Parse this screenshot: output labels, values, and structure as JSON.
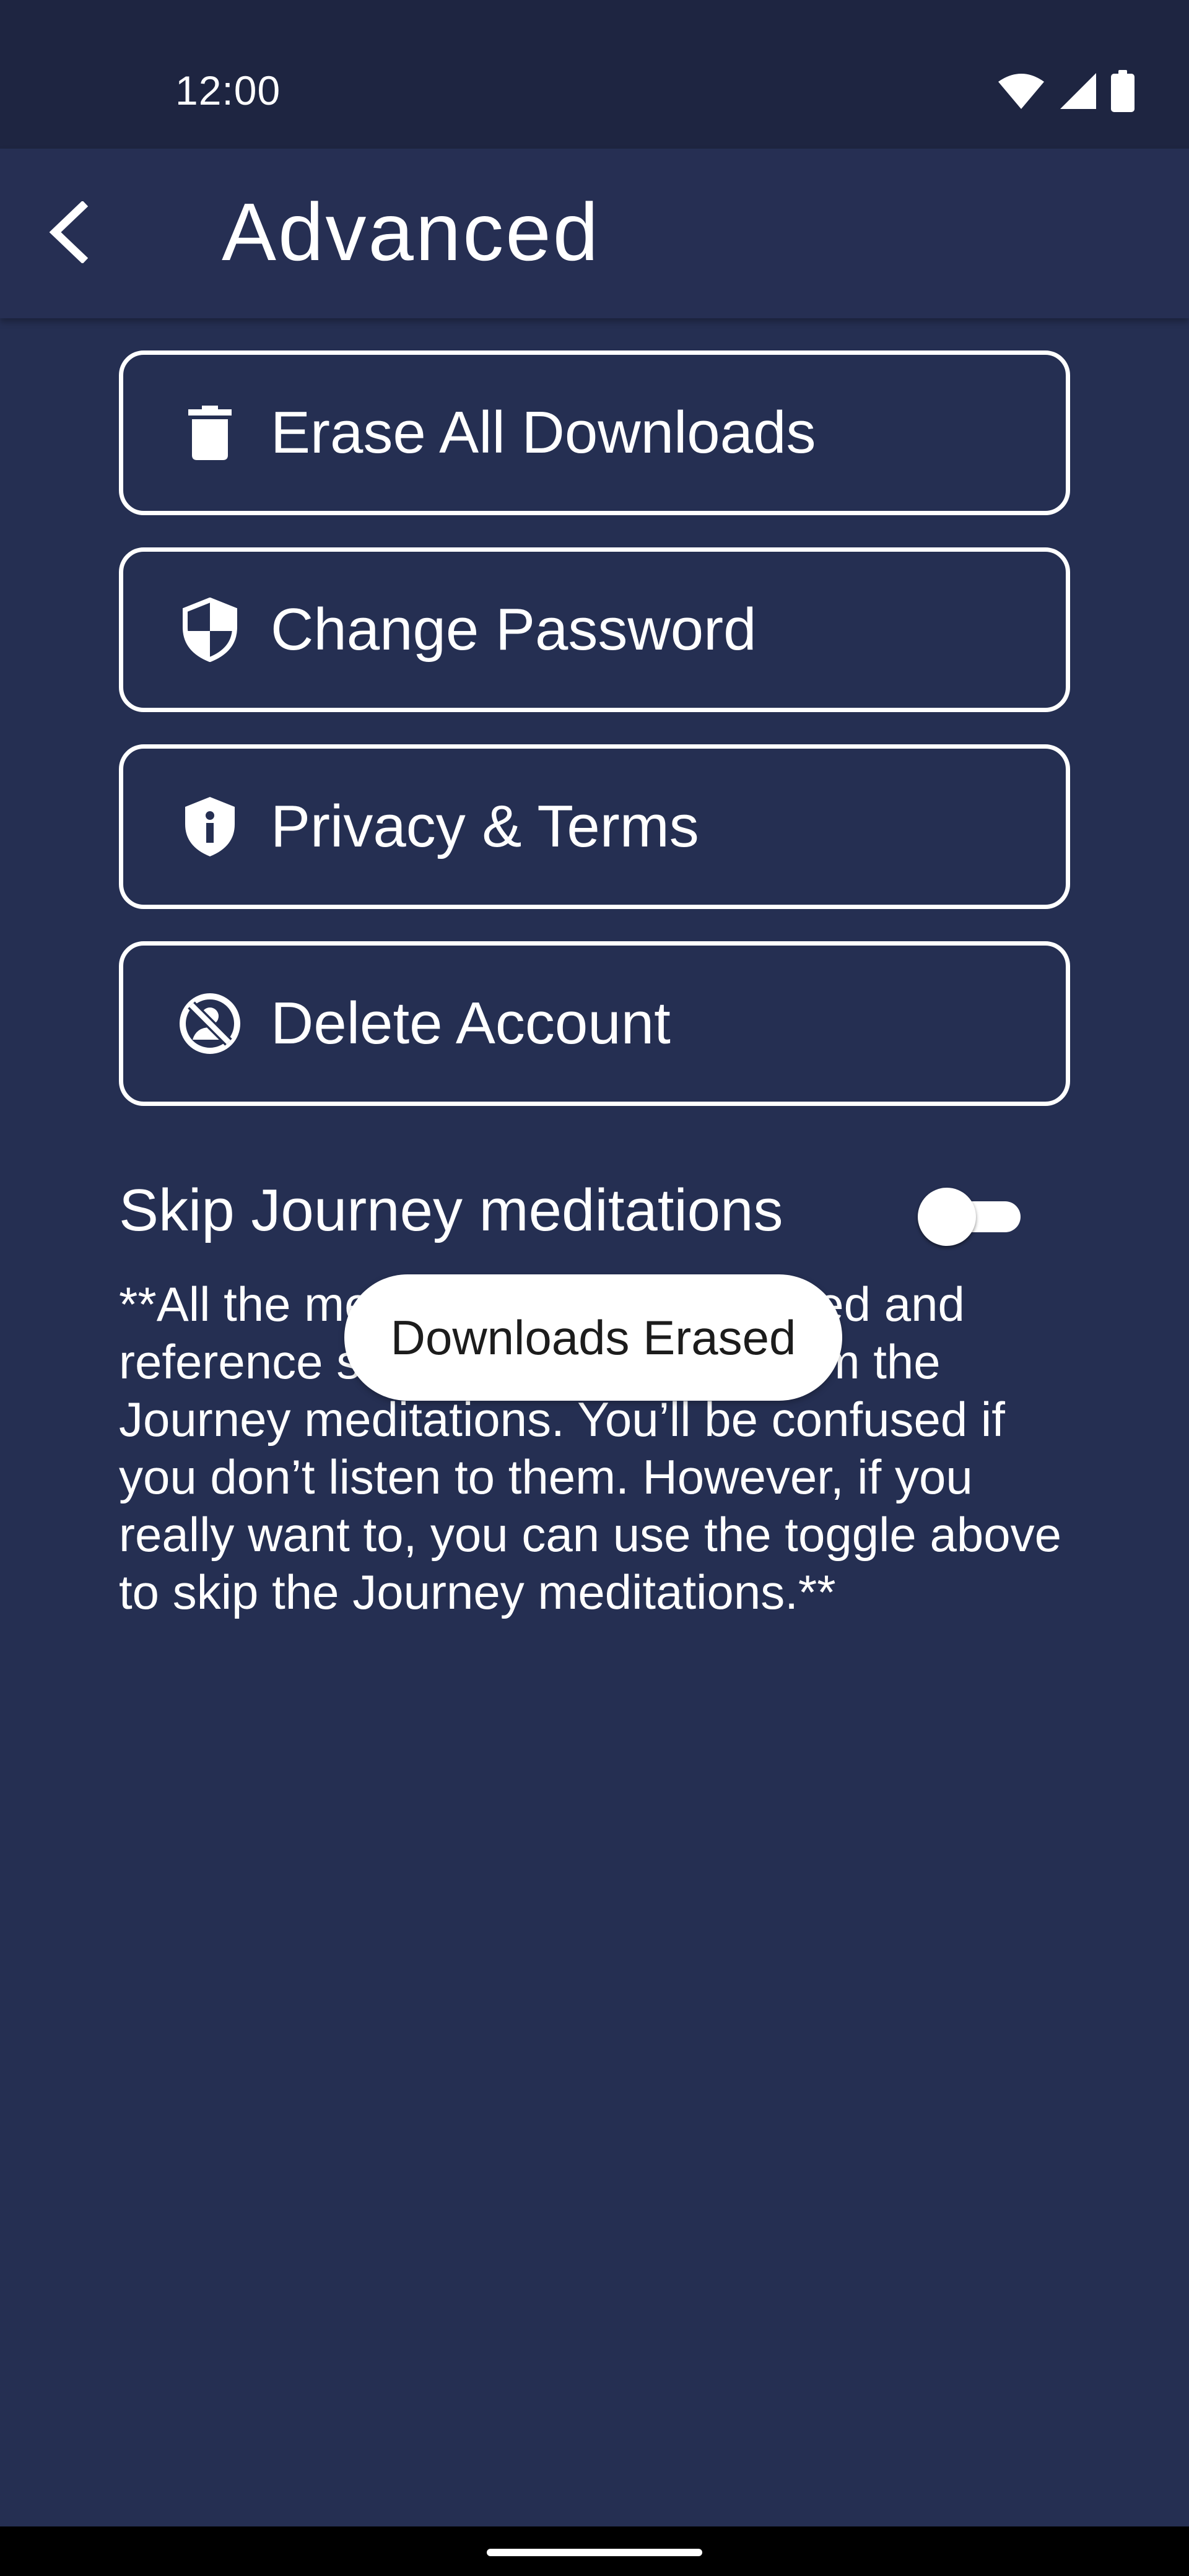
{
  "status_bar": {
    "time": "12:00",
    "icons": [
      "wifi-icon",
      "signal-icon",
      "battery-icon"
    ]
  },
  "app_bar": {
    "title": "Advanced",
    "back_icon": "chevron-left-icon"
  },
  "actions": [
    {
      "label": "Erase All Downloads",
      "icon": "trash-icon"
    },
    {
      "label": "Change Password",
      "icon": "shield-icon"
    },
    {
      "label": "Privacy & Terms",
      "icon": "info-shield-icon"
    },
    {
      "label": "Delete Account",
      "icon": "account-off-icon"
    }
  ],
  "skip_journey": {
    "label": "Skip Journey meditations",
    "enabled": false
  },
  "description": "**All the meditations are connected and reference stories and lessons from the Journey meditations. You’ll be confused if you don’t listen to them. However, if you really want to, you can use the toggle above to skip the Journey meditations.**",
  "toast": {
    "message": "Downloads Erased"
  },
  "colors": {
    "background": "#252f52",
    "app_bar": "#262f53",
    "status_bar": "#1e2541",
    "foreground": "#ffffff",
    "toast_bg": "#ffffff",
    "toast_text": "#1c1c1c"
  }
}
